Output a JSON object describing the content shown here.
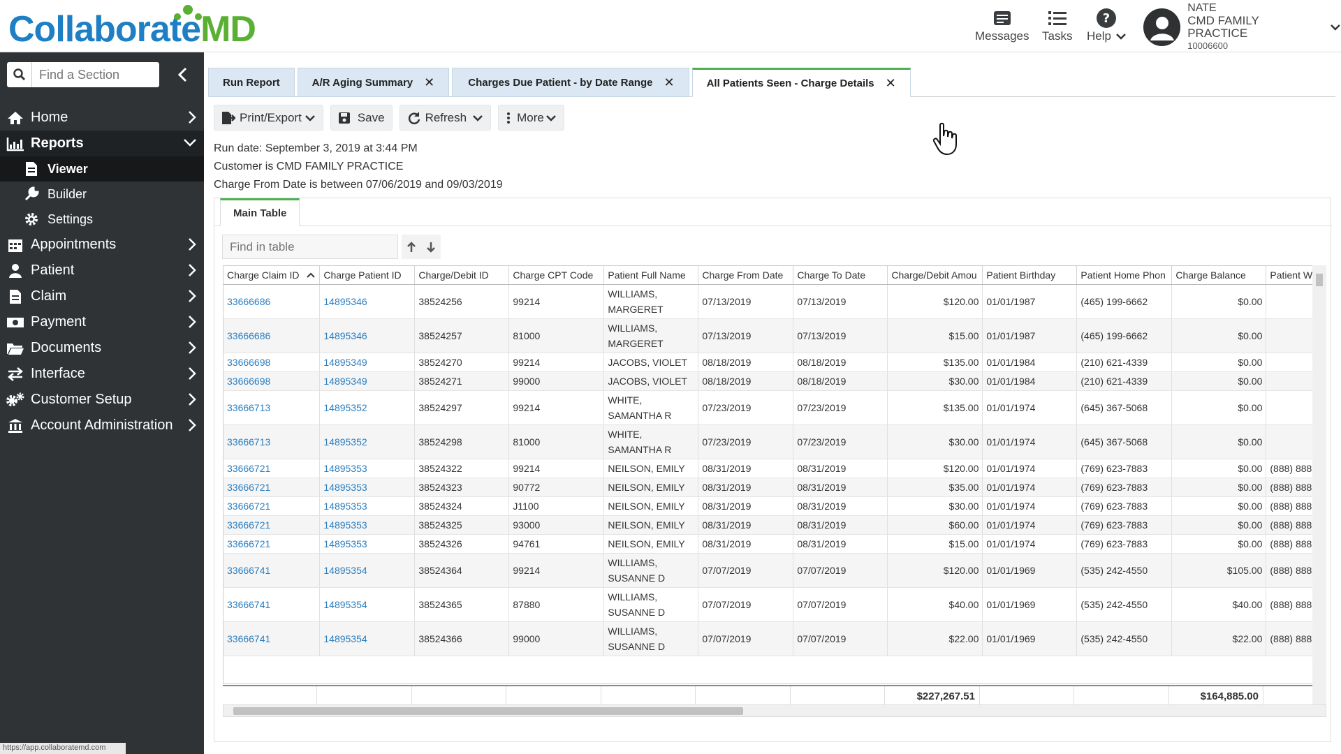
{
  "header": {
    "logo_part1": "Collaborate",
    "logo_part2": "MD",
    "messages_label": "Messages",
    "tasks_label": "Tasks",
    "help_label": "Help",
    "user_name": "NATE",
    "practice_name": "CMD FAMILY PRACTICE",
    "practice_id": "10006600"
  },
  "sidebar": {
    "search_placeholder": "Find a Section",
    "items": [
      {
        "label": "Home",
        "icon": "home-icon"
      },
      {
        "label": "Reports",
        "icon": "chart-icon",
        "expanded": true
      },
      {
        "label": "Appointments",
        "icon": "calendar-icon"
      },
      {
        "label": "Patient",
        "icon": "person-icon"
      },
      {
        "label": "Claim",
        "icon": "file-icon"
      },
      {
        "label": "Payment",
        "icon": "money-icon"
      },
      {
        "label": "Documents",
        "icon": "folder-icon"
      },
      {
        "label": "Interface",
        "icon": "exchange-icon"
      },
      {
        "label": "Customer Setup",
        "icon": "cogs-icon"
      },
      {
        "label": "Account Administration",
        "icon": "bank-icon"
      }
    ],
    "reports_sub": [
      {
        "label": "Viewer",
        "icon": "document-icon",
        "active": true
      },
      {
        "label": "Builder",
        "icon": "wrench-icon"
      },
      {
        "label": "Settings",
        "icon": "gear-icon"
      }
    ],
    "status_url": "https://app.collaboratemd.com"
  },
  "tabs": [
    {
      "label": "Run Report",
      "closable": false
    },
    {
      "label": "A/R Aging Summary",
      "closable": true
    },
    {
      "label": "Charges Due Patient - by Date Range",
      "closable": true
    },
    {
      "label": "All Patients Seen - Charge Details",
      "closable": true,
      "active": true
    }
  ],
  "toolbar": {
    "print_label": "Print/Export",
    "save_label": "Save",
    "refresh_label": "Refresh",
    "more_label": "More"
  },
  "meta": {
    "run_date": "Run date: September 3, 2019 at 3:44 PM",
    "customer": "Customer is CMD FAMILY PRACTICE",
    "date_range": "Charge From Date is between 07/06/2019 and 09/03/2019"
  },
  "subtab_label": "Main Table",
  "find_placeholder": "Find in table",
  "columns": [
    "Charge Claim ID",
    "Charge Patient ID",
    "Charge/Debit ID",
    "Charge CPT Code",
    "Patient Full Name",
    "Charge From Date",
    "Charge To Date",
    "Charge/Debit Amou",
    "Patient Birthday",
    "Patient Home Phon",
    "Charge Balance",
    "Patient W"
  ],
  "rows": [
    [
      "33666686",
      "14895346",
      "38524256",
      "99214",
      "WILLIAMS, MARGERET",
      "07/13/2019",
      "07/13/2019",
      "$120.00",
      "01/01/1987",
      "(465) 199-6662",
      "$0.00",
      ""
    ],
    [
      "33666686",
      "14895346",
      "38524257",
      "81000",
      "WILLIAMS, MARGERET",
      "07/13/2019",
      "07/13/2019",
      "$15.00",
      "01/01/1987",
      "(465) 199-6662",
      "$0.00",
      ""
    ],
    [
      "33666698",
      "14895349",
      "38524270",
      "99214",
      "JACOBS, VIOLET",
      "08/18/2019",
      "08/18/2019",
      "$135.00",
      "01/01/1984",
      "(210) 621-4339",
      "$0.00",
      ""
    ],
    [
      "33666698",
      "14895349",
      "38524271",
      "99000",
      "JACOBS, VIOLET",
      "08/18/2019",
      "08/18/2019",
      "$30.00",
      "01/01/1984",
      "(210) 621-4339",
      "$0.00",
      ""
    ],
    [
      "33666713",
      "14895352",
      "38524297",
      "99214",
      "WHITE, SAMANTHA R",
      "07/23/2019",
      "07/23/2019",
      "$135.00",
      "01/01/1974",
      "(645) 367-5068",
      "$0.00",
      ""
    ],
    [
      "33666713",
      "14895352",
      "38524298",
      "81000",
      "WHITE, SAMANTHA R",
      "07/23/2019",
      "07/23/2019",
      "$30.00",
      "01/01/1974",
      "(645) 367-5068",
      "$0.00",
      ""
    ],
    [
      "33666721",
      "14895353",
      "38524322",
      "99214",
      "NEILSON, EMILY",
      "08/31/2019",
      "08/31/2019",
      "$120.00",
      "01/01/1974",
      "(769) 623-7883",
      "$0.00",
      "(888) 888-"
    ],
    [
      "33666721",
      "14895353",
      "38524323",
      "90772",
      "NEILSON, EMILY",
      "08/31/2019",
      "08/31/2019",
      "$35.00",
      "01/01/1974",
      "(769) 623-7883",
      "$0.00",
      "(888) 888-"
    ],
    [
      "33666721",
      "14895353",
      "38524324",
      "J1100",
      "NEILSON, EMILY",
      "08/31/2019",
      "08/31/2019",
      "$30.00",
      "01/01/1974",
      "(769) 623-7883",
      "$0.00",
      "(888) 888-"
    ],
    [
      "33666721",
      "14895353",
      "38524325",
      "93000",
      "NEILSON, EMILY",
      "08/31/2019",
      "08/31/2019",
      "$60.00",
      "01/01/1974",
      "(769) 623-7883",
      "$0.00",
      "(888) 888-"
    ],
    [
      "33666721",
      "14895353",
      "38524326",
      "94761",
      "NEILSON, EMILY",
      "08/31/2019",
      "08/31/2019",
      "$15.00",
      "01/01/1974",
      "(769) 623-7883",
      "$0.00",
      "(888) 888-"
    ],
    [
      "33666741",
      "14895354",
      "38524364",
      "99214",
      "WILLIAMS, SUSANNE D",
      "07/07/2019",
      "07/07/2019",
      "$120.00",
      "01/01/1969",
      "(535) 242-4550",
      "$105.00",
      "(888) 888-"
    ],
    [
      "33666741",
      "14895354",
      "38524365",
      "87880",
      "WILLIAMS, SUSANNE D",
      "07/07/2019",
      "07/07/2019",
      "$40.00",
      "01/01/1969",
      "(535) 242-4550",
      "$40.00",
      "(888) 888-"
    ],
    [
      "33666741",
      "14895354",
      "38524366",
      "99000",
      "WILLIAMS, SUSANNE D",
      "07/07/2019",
      "07/07/2019",
      "$22.00",
      "01/01/1969",
      "(535) 242-4550",
      "$22.00",
      "(888) 888-"
    ]
  ],
  "totals": {
    "amount": "$227,267.51",
    "balance": "$164,885.00"
  }
}
